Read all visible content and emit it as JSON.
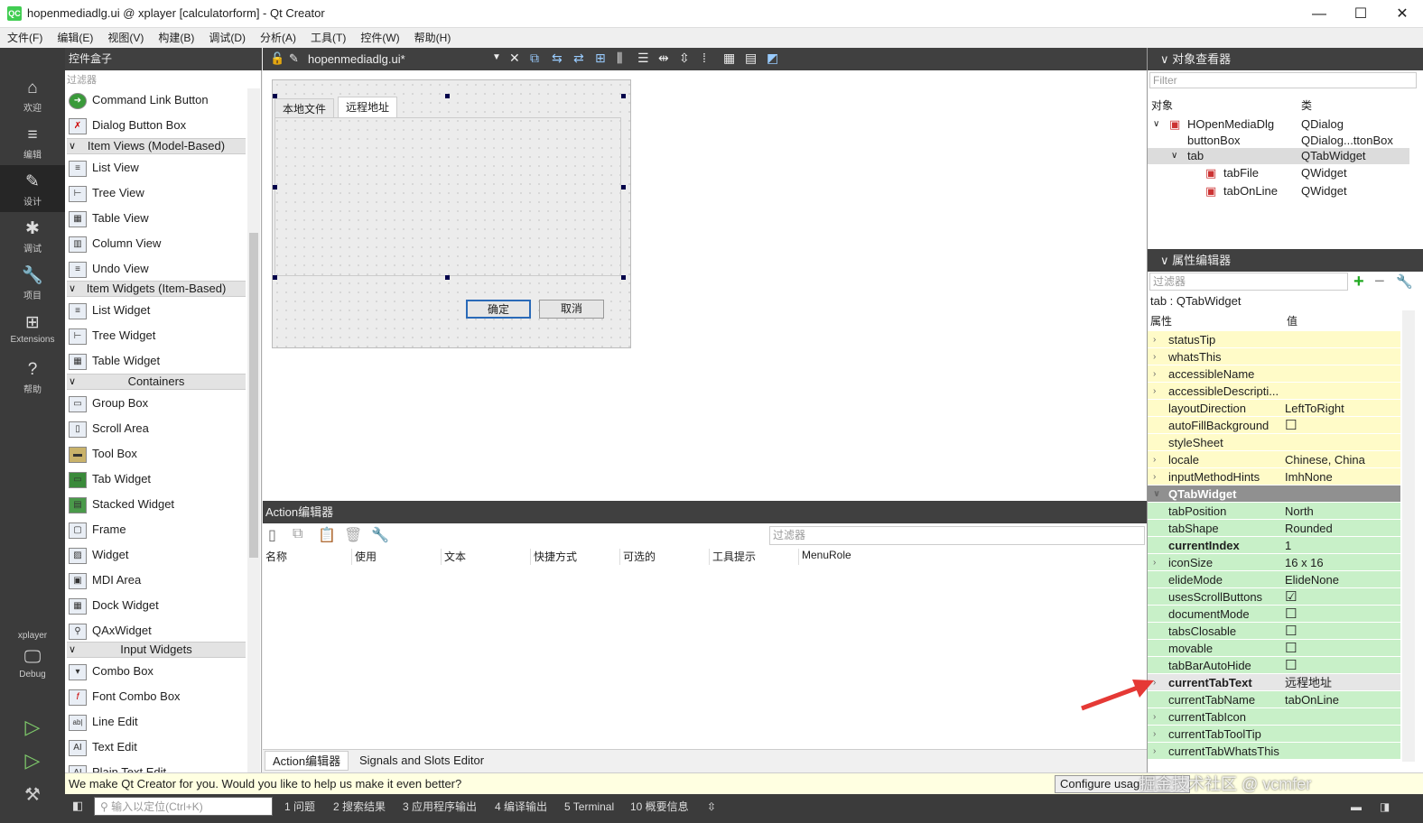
{
  "titlebar": {
    "title": "hopenmediadlg.ui @ xplayer [calculatorform] - Qt Creator",
    "app_icon": "QC",
    "minimize": "—",
    "maximize": "☐",
    "close": "✕"
  },
  "menu": [
    "文件(F)",
    "编辑(E)",
    "视图(V)",
    "构建(B)",
    "调试(D)",
    "分析(A)",
    "工具(T)",
    "控件(W)",
    "帮助(H)"
  ],
  "modes": [
    {
      "label": "欢迎",
      "icon": "⌂"
    },
    {
      "label": "编辑",
      "icon": "≡"
    },
    {
      "label": "设计",
      "icon": "✎"
    },
    {
      "label": "调试",
      "icon": "✱"
    },
    {
      "label": "项目",
      "icon": "🔧"
    },
    {
      "label": "Extensions",
      "icon": "⊞"
    },
    {
      "label": "帮助",
      "icon": "?"
    }
  ],
  "kit": {
    "project": "xplayer",
    "config": "Debug"
  },
  "toolbox": {
    "title": "控件盒子",
    "filter_placeholder": "过滤器",
    "items": [
      "Command Link Button",
      "Dialog Button Box",
      "List View",
      "Tree View",
      "Table View",
      "Column View",
      "Undo View",
      "List Widget",
      "Tree Widget",
      "Table Widget",
      "Group Box",
      "Scroll Area",
      "Tool Box",
      "Tab Widget",
      "Stacked Widget",
      "Frame",
      "Widget",
      "MDI Area",
      "Dock Widget",
      "QAxWidget",
      "Combo Box",
      "Font Combo Box",
      "Line Edit",
      "Text Edit",
      "Plain Text Edit"
    ],
    "categories": [
      "Item Views (Model-Based)",
      "Item Widgets (Item-Based)",
      "Containers",
      "Input Widgets"
    ]
  },
  "editor": {
    "filename": "hopenmediadlg.ui*"
  },
  "form": {
    "tabs": [
      "本地文件",
      "远程地址"
    ],
    "ok": "确定",
    "cancel": "取消"
  },
  "action_editor": {
    "title": "Action编辑器",
    "filter_placeholder": "过滤器",
    "columns": [
      "名称",
      "使用",
      "文本",
      "快捷方式",
      "可选的",
      "工具提示",
      "MenuRole"
    ],
    "tabs": [
      "Action编辑器",
      "Signals and Slots Editor"
    ]
  },
  "object_inspector": {
    "title": "对象查看器",
    "filter_placeholder": "Filter",
    "col_object": "对象",
    "col_class": "类",
    "rows": [
      {
        "name": "HOpenMediaDlg",
        "cls": "QDialog"
      },
      {
        "name": "buttonBox",
        "cls": "QDialog...ttonBox"
      },
      {
        "name": "tab",
        "cls": "QTabWidget"
      },
      {
        "name": "tabFile",
        "cls": "QWidget"
      },
      {
        "name": "tabOnLine",
        "cls": "QWidget"
      }
    ]
  },
  "property_editor": {
    "title": "属性编辑器",
    "filter_placeholder": "过滤器",
    "context": "tab : QTabWidget",
    "col_prop": "属性",
    "col_value": "值",
    "rows": [
      {
        "name": "statusTip",
        "value": "",
        "exp": true
      },
      {
        "name": "whatsThis",
        "value": "",
        "exp": true
      },
      {
        "name": "accessibleName",
        "value": "",
        "exp": true
      },
      {
        "name": "accessibleDescripti...",
        "value": "",
        "exp": true
      },
      {
        "name": "layoutDirection",
        "value": "LeftToRight"
      },
      {
        "name": "autoFillBackground",
        "value": "☐"
      },
      {
        "name": "styleSheet",
        "value": ""
      },
      {
        "name": "locale",
        "value": "Chinese, China",
        "exp": true
      },
      {
        "name": "inputMethodHints",
        "value": "ImhNone",
        "exp": true
      },
      {
        "name": "QTabWidget",
        "value": "",
        "group": true
      },
      {
        "name": "tabPosition",
        "value": "North"
      },
      {
        "name": "tabShape",
        "value": "Rounded"
      },
      {
        "name": "currentIndex",
        "value": "1",
        "bold": true
      },
      {
        "name": "iconSize",
        "value": "16 x 16",
        "exp": true
      },
      {
        "name": "elideMode",
        "value": "ElideNone"
      },
      {
        "name": "usesScrollButtons",
        "value": "☑"
      },
      {
        "name": "documentMode",
        "value": "☐"
      },
      {
        "name": "tabsClosable",
        "value": "☐"
      },
      {
        "name": "movable",
        "value": "☐"
      },
      {
        "name": "tabBarAutoHide",
        "value": "☐"
      },
      {
        "name": "currentTabText",
        "value": "远程地址",
        "bold": true,
        "exp": true
      },
      {
        "name": "currentTabName",
        "value": "tabOnLine"
      },
      {
        "name": "currentTabIcon",
        "value": "",
        "exp": true
      },
      {
        "name": "currentTabToolTip",
        "value": "",
        "exp": true
      },
      {
        "name": "currentTabWhatsThis",
        "value": "",
        "exp": true
      }
    ]
  },
  "infobar": {
    "message": "We make Qt Creator for you. Would you like to help us make it even better?",
    "configure": "Configure usag",
    "watermark": "掘金技术社区 @ vcmfer"
  },
  "statusbar": {
    "locator_placeholder": "输入以定位(Ctrl+K)",
    "panes": [
      "1 问题",
      "2 搜索结果",
      "3 应用程序输出",
      "4 编译输出",
      "5 Terminal",
      "10 概要信息"
    ]
  }
}
